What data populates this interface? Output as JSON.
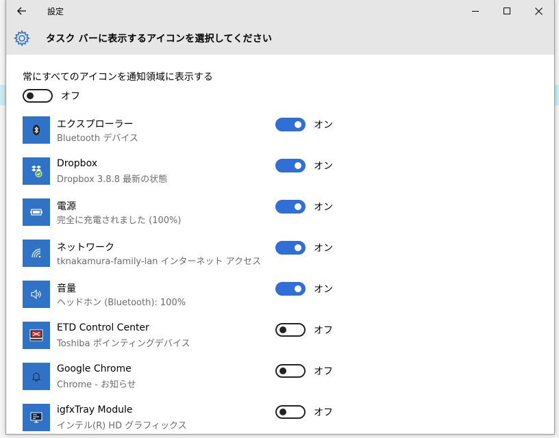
{
  "window": {
    "title": "設定",
    "page_title": "タスク バーに表示するアイコンを選択してください"
  },
  "master": {
    "label": "常にすべてのアイコンを通知領域に表示する",
    "state": "オフ",
    "on": false
  },
  "apps": [
    {
      "name": "エクスプローラー",
      "desc": "Bluetooth デバイス",
      "state": "オン",
      "on": true,
      "icon": "bluetooth-icon"
    },
    {
      "name": "Dropbox",
      "desc": "Dropbox 3.8.8 最新の状態",
      "state": "オン",
      "on": true,
      "icon": "dropbox-icon"
    },
    {
      "name": "電源",
      "desc": "完全に充電されました (100%)",
      "state": "オン",
      "on": true,
      "icon": "battery-icon"
    },
    {
      "name": "ネットワーク",
      "desc": "tknakamura-family-lan インターネット アクセス",
      "state": "オン",
      "on": true,
      "icon": "wifi-icon"
    },
    {
      "name": "音量",
      "desc": "ヘッドホン (Bluetooth): 100%",
      "state": "オン",
      "on": true,
      "icon": "speaker-icon"
    },
    {
      "name": "ETD Control Center",
      "desc": "Toshiba ポインティングデバイス",
      "state": "オフ",
      "on": false,
      "icon": "touchpad-icon"
    },
    {
      "name": "Google Chrome",
      "desc": "Chrome - お知らせ",
      "state": "オフ",
      "on": false,
      "icon": "bell-icon"
    },
    {
      "name": "igfxTray Module",
      "desc": "インテル(R) HD グラフィックス",
      "state": "オフ",
      "on": false,
      "icon": "display-icon"
    }
  ],
  "colors": {
    "accent": "#2f6fd6",
    "icon_tile": "#2f72c6",
    "titlebar": "#e6e6e6",
    "secondary_text": "#6b6b6b"
  }
}
